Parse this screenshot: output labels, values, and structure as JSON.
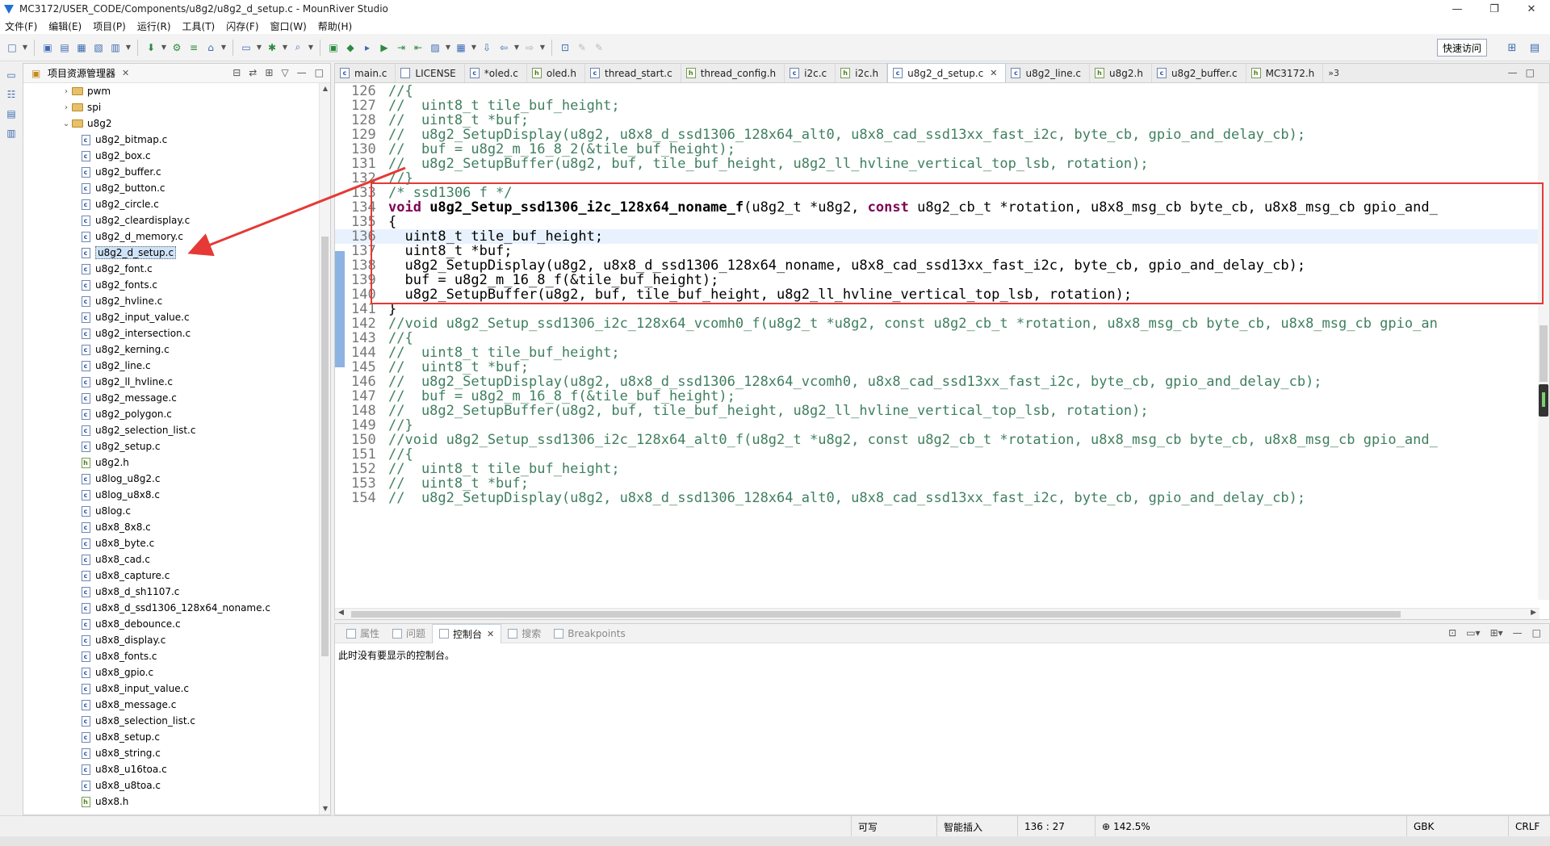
{
  "window": {
    "title": "MC3172/USER_CODE/Components/u8g2/u8g2_d_setup.c - MounRiver Studio",
    "controls": [
      "—",
      "❐",
      "✕"
    ]
  },
  "menu": [
    "文件(F)",
    "编辑(E)",
    "项目(P)",
    "运行(R)",
    "工具(T)",
    "闪存(F)",
    "窗口(W)",
    "帮助(H)"
  ],
  "toolbar": {
    "quick_access": "快速访问"
  },
  "explorer": {
    "title": "项目资源管理器",
    "items": [
      {
        "name": "pwm",
        "type": "folder",
        "twisty": "›",
        "indent": 0
      },
      {
        "name": "spi",
        "type": "folder",
        "twisty": "›",
        "indent": 0
      },
      {
        "name": "u8g2",
        "type": "folder",
        "twisty": "⌄",
        "indent": 0
      },
      {
        "name": "u8g2_bitmap.c",
        "type": "c",
        "indent": 1
      },
      {
        "name": "u8g2_box.c",
        "type": "c",
        "indent": 1
      },
      {
        "name": "u8g2_buffer.c",
        "type": "c",
        "indent": 1
      },
      {
        "name": "u8g2_button.c",
        "type": "c",
        "indent": 1
      },
      {
        "name": "u8g2_circle.c",
        "type": "c",
        "indent": 1
      },
      {
        "name": "u8g2_cleardisplay.c",
        "type": "c",
        "indent": 1
      },
      {
        "name": "u8g2_d_memory.c",
        "type": "c",
        "indent": 1
      },
      {
        "name": "u8g2_d_setup.c",
        "type": "c",
        "indent": 1,
        "selected": true
      },
      {
        "name": "u8g2_font.c",
        "type": "c",
        "indent": 1
      },
      {
        "name": "u8g2_fonts.c",
        "type": "c",
        "indent": 1
      },
      {
        "name": "u8g2_hvline.c",
        "type": "c",
        "indent": 1
      },
      {
        "name": "u8g2_input_value.c",
        "type": "c",
        "indent": 1
      },
      {
        "name": "u8g2_intersection.c",
        "type": "c",
        "indent": 1
      },
      {
        "name": "u8g2_kerning.c",
        "type": "c",
        "indent": 1
      },
      {
        "name": "u8g2_line.c",
        "type": "c",
        "indent": 1
      },
      {
        "name": "u8g2_ll_hvline.c",
        "type": "c",
        "indent": 1
      },
      {
        "name": "u8g2_message.c",
        "type": "c",
        "indent": 1
      },
      {
        "name": "u8g2_polygon.c",
        "type": "c",
        "indent": 1
      },
      {
        "name": "u8g2_selection_list.c",
        "type": "c",
        "indent": 1
      },
      {
        "name": "u8g2_setup.c",
        "type": "c",
        "indent": 1
      },
      {
        "name": "u8g2.h",
        "type": "h",
        "indent": 1
      },
      {
        "name": "u8log_u8g2.c",
        "type": "c",
        "indent": 1
      },
      {
        "name": "u8log_u8x8.c",
        "type": "c",
        "indent": 1
      },
      {
        "name": "u8log.c",
        "type": "c",
        "indent": 1
      },
      {
        "name": "u8x8_8x8.c",
        "type": "c",
        "indent": 1
      },
      {
        "name": "u8x8_byte.c",
        "type": "c",
        "indent": 1
      },
      {
        "name": "u8x8_cad.c",
        "type": "c",
        "indent": 1
      },
      {
        "name": "u8x8_capture.c",
        "type": "c",
        "indent": 1
      },
      {
        "name": "u8x8_d_sh1107.c",
        "type": "c",
        "indent": 1
      },
      {
        "name": "u8x8_d_ssd1306_128x64_noname.c",
        "type": "c",
        "indent": 1
      },
      {
        "name": "u8x8_debounce.c",
        "type": "c",
        "indent": 1
      },
      {
        "name": "u8x8_display.c",
        "type": "c",
        "indent": 1
      },
      {
        "name": "u8x8_fonts.c",
        "type": "c",
        "indent": 1
      },
      {
        "name": "u8x8_gpio.c",
        "type": "c",
        "indent": 1
      },
      {
        "name": "u8x8_input_value.c",
        "type": "c",
        "indent": 1
      },
      {
        "name": "u8x8_message.c",
        "type": "c",
        "indent": 1
      },
      {
        "name": "u8x8_selection_list.c",
        "type": "c",
        "indent": 1
      },
      {
        "name": "u8x8_setup.c",
        "type": "c",
        "indent": 1
      },
      {
        "name": "u8x8_string.c",
        "type": "c",
        "indent": 1
      },
      {
        "name": "u8x8_u16toa.c",
        "type": "c",
        "indent": 1
      },
      {
        "name": "u8x8_u8toa.c",
        "type": "c",
        "indent": 1
      },
      {
        "name": "u8x8.h",
        "type": "h",
        "indent": 1
      }
    ]
  },
  "editor": {
    "tabs": [
      {
        "label": "main.c",
        "type": "c"
      },
      {
        "label": "LICENSE",
        "type": "txt"
      },
      {
        "label": "*oled.c",
        "type": "c"
      },
      {
        "label": "oled.h",
        "type": "h"
      },
      {
        "label": "thread_start.c",
        "type": "c"
      },
      {
        "label": "thread_config.h",
        "type": "h"
      },
      {
        "label": "i2c.c",
        "type": "c"
      },
      {
        "label": "i2c.h",
        "type": "h"
      },
      {
        "label": "u8g2_d_setup.c",
        "type": "c",
        "active": true
      },
      {
        "label": "u8g2_line.c",
        "type": "c"
      },
      {
        "label": "u8g2.h",
        "type": "h"
      },
      {
        "label": "u8g2_buffer.c",
        "type": "c"
      },
      {
        "label": "MC3172.h",
        "type": "h"
      }
    ],
    "more_tabs": "»3",
    "lines": [
      {
        "n": "126",
        "t": "//{",
        "kind": "comment"
      },
      {
        "n": "127",
        "t": "//  uint8_t tile_buf_height;",
        "kind": "comment"
      },
      {
        "n": "128",
        "t": "//  uint8_t *buf;",
        "kind": "comment"
      },
      {
        "n": "129",
        "t": "//  u8g2_SetupDisplay(u8g2, u8x8_d_ssd1306_128x64_alt0, u8x8_cad_ssd13xx_fast_i2c, byte_cb, gpio_and_delay_cb);",
        "kind": "comment"
      },
      {
        "n": "130",
        "t": "//  buf = u8g2_m_16_8_2(&tile_buf_height);",
        "kind": "comment"
      },
      {
        "n": "131",
        "t": "//  u8g2_SetupBuffer(u8g2, buf, tile_buf_height, u8g2_ll_hvline_vertical_top_lsb, rotation);",
        "kind": "comment"
      },
      {
        "n": "132",
        "t": "//}",
        "kind": "comment"
      },
      {
        "n": "133",
        "t": "/* ssd1306 f */",
        "kind": "comment"
      },
      {
        "n": "134",
        "kw1": "void ",
        "fn": "u8g2_Setup_ssd1306_i2c_128x64_noname_f",
        "rest1": "(u8g2_t *u8g2, ",
        "kw2": "const",
        "rest2": " u8g2_cb_t *rotation, u8x8_msg_cb byte_cb, u8x8_msg_cb gpio_and_",
        "kind": "decl"
      },
      {
        "n": "135",
        "t": "{",
        "kind": "normal"
      },
      {
        "n": "136",
        "t": "  uint8_t tile_buf_height;",
        "kind": "normal",
        "highlight": true
      },
      {
        "n": "137",
        "t": "  uint8_t *buf;",
        "kind": "normal"
      },
      {
        "n": "138",
        "t": "  u8g2_SetupDisplay(u8g2, u8x8_d_ssd1306_128x64_noname, u8x8_cad_ssd13xx_fast_i2c, byte_cb, gpio_and_delay_cb);",
        "kind": "normal"
      },
      {
        "n": "139",
        "t": "  buf = u8g2_m_16_8_f(&tile_buf_height);",
        "kind": "normal"
      },
      {
        "n": "140",
        "t": "  u8g2_SetupBuffer(u8g2, buf, tile_buf_height, u8g2_ll_hvline_vertical_top_lsb, rotation);",
        "kind": "normal"
      },
      {
        "n": "141",
        "t": "}",
        "kind": "normal"
      },
      {
        "n": "142",
        "t": "//void u8g2_Setup_ssd1306_i2c_128x64_vcomh0_f(u8g2_t *u8g2, const u8g2_cb_t *rotation, u8x8_msg_cb byte_cb, u8x8_msg_cb gpio_an",
        "kind": "comment"
      },
      {
        "n": "143",
        "t": "//{",
        "kind": "comment"
      },
      {
        "n": "144",
        "t": "//  uint8_t tile_buf_height;",
        "kind": "comment"
      },
      {
        "n": "145",
        "t": "//  uint8_t *buf;",
        "kind": "comment"
      },
      {
        "n": "146",
        "t": "//  u8g2_SetupDisplay(u8g2, u8x8_d_ssd1306_128x64_vcomh0, u8x8_cad_ssd13xx_fast_i2c, byte_cb, gpio_and_delay_cb);",
        "kind": "comment"
      },
      {
        "n": "147",
        "t": "//  buf = u8g2_m_16_8_f(&tile_buf_height);",
        "kind": "comment"
      },
      {
        "n": "148",
        "t": "//  u8g2_SetupBuffer(u8g2, buf, tile_buf_height, u8g2_ll_hvline_vertical_top_lsb, rotation);",
        "kind": "comment"
      },
      {
        "n": "149",
        "t": "//}",
        "kind": "comment"
      },
      {
        "n": "150",
        "t": "//void u8g2_Setup_ssd1306_i2c_128x64_alt0_f(u8g2_t *u8g2, const u8g2_cb_t *rotation, u8x8_msg_cb byte_cb, u8x8_msg_cb gpio_and_",
        "kind": "comment"
      },
      {
        "n": "151",
        "t": "//{",
        "kind": "comment"
      },
      {
        "n": "152",
        "t": "//  uint8_t tile_buf_height;",
        "kind": "comment"
      },
      {
        "n": "153",
        "t": "//  uint8_t *buf;",
        "kind": "comment"
      },
      {
        "n": "154",
        "t": "//  u8g2_SetupDisplay(u8g2, u8x8_d_ssd1306_128x64_alt0, u8x8_cad_ssd13xx_fast_i2c, byte_cb, gpio_and_delay_cb);",
        "kind": "comment"
      }
    ]
  },
  "console": {
    "tabs": [
      {
        "label": "属性"
      },
      {
        "label": "问题"
      },
      {
        "label": "控制台",
        "active": true
      },
      {
        "label": "搜索"
      },
      {
        "label": "Breakpoints"
      }
    ],
    "message": "此时没有要显示的控制台。"
  },
  "statusbar": {
    "writable": "可写",
    "insert_mode": "智能插入",
    "position": "136 : 27",
    "zoom": "142.5%",
    "encoding": "GBK",
    "line_ending": "CRLF"
  },
  "colors": {
    "annotation": "#e53935",
    "comment": "#3f7f5f",
    "keyword": "#7f0055"
  }
}
